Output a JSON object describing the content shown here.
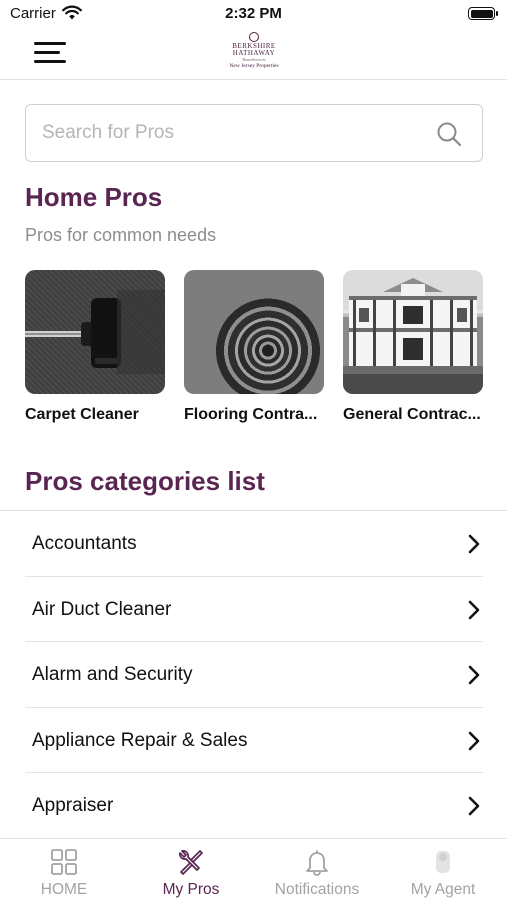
{
  "status_bar": {
    "carrier": "Carrier",
    "time": "2:32 PM"
  },
  "nav": {
    "logo_line1": "BERKSHIRE",
    "logo_line2": "HATHAWAY",
    "logo_line3": "HomeServices",
    "logo_line4": "New Jersey Properties"
  },
  "search": {
    "placeholder": "Search for Pros",
    "value": ""
  },
  "home_pros": {
    "title": "Home Pros",
    "subtitle": "Pros for common needs",
    "cards": [
      {
        "label": "Carpet Cleaner",
        "image": "carpet-vacuum-photo"
      },
      {
        "label": "Flooring Contra...",
        "image": "rolled-carpet-photo"
      },
      {
        "label": "General Contrac...",
        "image": "house-photo"
      }
    ]
  },
  "categories": {
    "title": "Pros categories list",
    "items": [
      {
        "label": "Accountants"
      },
      {
        "label": "Air Duct Cleaner"
      },
      {
        "label": "Alarm and Security"
      },
      {
        "label": "Appliance Repair & Sales"
      },
      {
        "label": "Appraiser"
      }
    ]
  },
  "tab_bar": {
    "tabs": [
      {
        "label": "HOME",
        "icon": "grid-icon",
        "active": false
      },
      {
        "label": "My Pros",
        "icon": "tools-icon",
        "active": true
      },
      {
        "label": "Notifications",
        "icon": "bell-icon",
        "active": false
      },
      {
        "label": "My Agent",
        "icon": "agent-avatar-icon",
        "active": false
      }
    ]
  },
  "colors": {
    "brand": "#5a2551",
    "muted_text": "#8d8d8d",
    "inactive_tab": "#a3a3a3"
  }
}
